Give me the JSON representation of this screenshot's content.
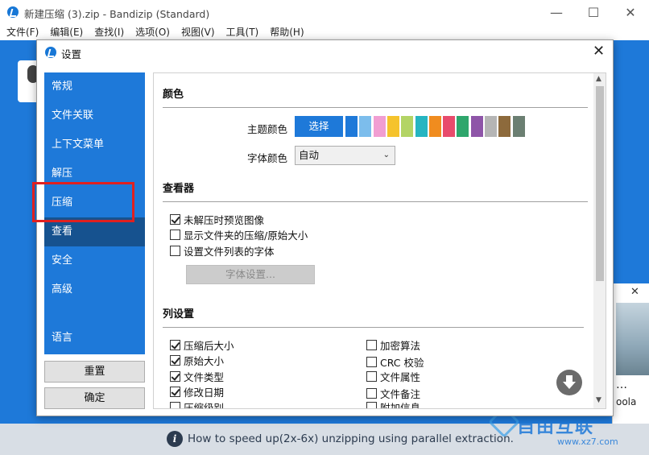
{
  "window": {
    "title": "新建压缩 (3).zip - Bandizip (Standard)",
    "minimize_symbol": "—",
    "maximize_symbol": "☐",
    "close_symbol": "✕"
  },
  "menubar": [
    "文件(F)",
    "编辑(E)",
    "查找(I)",
    "选项(O)",
    "视图(V)",
    "工具(T)",
    "帮助(H)"
  ],
  "dialog": {
    "title": "设置",
    "close_symbol": "✕",
    "sidebar": {
      "items": [
        "常规",
        "文件关联",
        "上下文菜单",
        "解压",
        "压缩",
        "查看",
        "安全",
        "高级",
        "语言"
      ],
      "active_item": "查看",
      "highlighted_item": "压缩",
      "reset_label": "重置",
      "ok_label": "确定"
    },
    "content": {
      "color_section": {
        "title": "颜色",
        "theme_color_label": "主题颜色",
        "select_button": "选择",
        "swatches": [
          "#1e79d9",
          "#7cbdec",
          "#f19ed2",
          "#f5c32c",
          "#b3d465",
          "#26b5c1",
          "#f08c1f",
          "#e84b6c",
          "#2ea66c",
          "#8e55a8",
          "#b5b5b5",
          "#8d6a3c",
          "#6b7f72"
        ],
        "font_color_label": "字体颜色",
        "font_color_value": "自动"
      },
      "viewer_section": {
        "title": "查看器",
        "options": [
          {
            "label": "未解压时预览图像",
            "checked": true
          },
          {
            "label": "显示文件夹的压缩/原始大小",
            "checked": false
          },
          {
            "label": "设置文件列表的字体",
            "checked": false
          }
        ],
        "font_settings_button": "字体设置..."
      },
      "columns_section": {
        "title": "列设置",
        "left_options": [
          {
            "label": "压缩后大小",
            "checked": true
          },
          {
            "label": "原始大小",
            "checked": true
          },
          {
            "label": "文件类型",
            "checked": true
          },
          {
            "label": "修改日期",
            "checked": true
          },
          {
            "label": "压缩级别",
            "checked": false
          }
        ],
        "right_options": [
          {
            "label": "加密算法",
            "checked": false
          },
          {
            "label": "CRC 校验",
            "checked": false
          },
          {
            "label": "文件属性",
            "checked": false
          },
          {
            "label": "文件备注",
            "checked": false
          },
          {
            "label": "附加信息",
            "checked": false
          }
        ]
      }
    }
  },
  "ad": {
    "close_symbol": "✕",
    "dots": "…",
    "text": "oola"
  },
  "statusbar": {
    "info_symbol": "i",
    "text": "How to speed up(2x-6x) unzipping using parallel extraction."
  },
  "watermark": {
    "main": "自由互联",
    "sub": "www.xz7.com"
  }
}
